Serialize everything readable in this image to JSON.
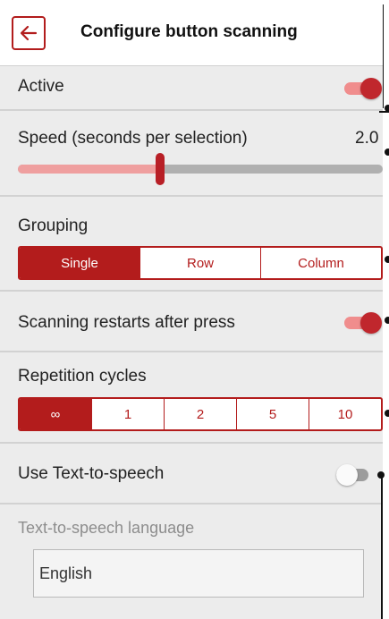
{
  "header": {
    "title": "Configure button scanning",
    "back_icon": "arrow-left-icon"
  },
  "active": {
    "label": "Active",
    "on": true
  },
  "speed": {
    "label": "Speed (seconds per selection)",
    "value": "2.0",
    "fraction": 0.39
  },
  "grouping": {
    "label": "Grouping",
    "options": [
      "Single",
      "Row",
      "Column"
    ],
    "selected": 0
  },
  "restart": {
    "label": "Scanning restarts after press",
    "on": true
  },
  "repetition": {
    "label": "Repetition cycles",
    "options": [
      "∞",
      "1",
      "2",
      "5",
      "10"
    ],
    "selected": 0
  },
  "tts": {
    "label": "Use Text-to-speech",
    "on": false
  },
  "tts_language": {
    "label": "Text-to-speech language",
    "value": "English"
  },
  "colors": {
    "accent": "#b31c1c",
    "toggle_track_on": "#f08d8d",
    "panel_bg": "#ececec"
  }
}
